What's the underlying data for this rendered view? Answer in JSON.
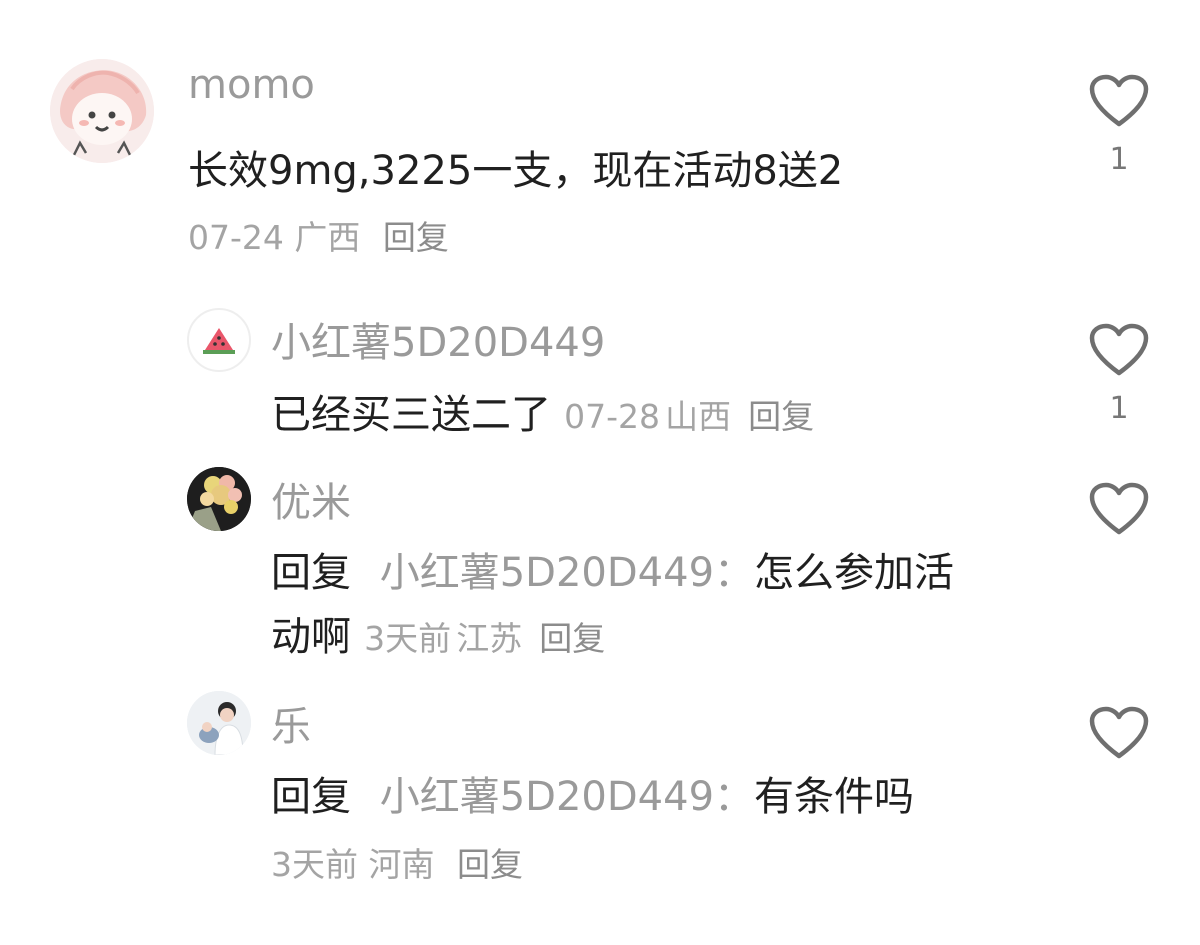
{
  "comments": [
    {
      "user": "momo",
      "text": "长效9mg,3225一支，现在活动8送2",
      "date": "07-24",
      "region": "广西",
      "reply_label": "回复",
      "likes": "1"
    },
    {
      "user": "小红薯5D20D449",
      "text": "已经买三送二了",
      "date": "07-28",
      "region": "山西",
      "reply_label": "回复",
      "likes": "1"
    },
    {
      "user": "优米",
      "reply_prefix": "回复",
      "reply_to": "小红薯5D20D449",
      "colon": "：",
      "text_line1": "怎么参加活",
      "text_line2": "动啊",
      "date": "3天前",
      "region": "江苏",
      "reply_label": "回复"
    },
    {
      "user": "乐",
      "reply_prefix": "回复",
      "reply_to": "小红薯5D20D449",
      "colon": "：",
      "text": "有条件吗",
      "date": "3天前",
      "region": "河南",
      "reply_label": "回复"
    }
  ],
  "colors": {
    "name": "#9a9a9a",
    "text": "#202020",
    "meta": "#a4a4a4",
    "like_outline": "#6f6f6f"
  },
  "icons": {
    "like": "heart-outline-icon"
  }
}
